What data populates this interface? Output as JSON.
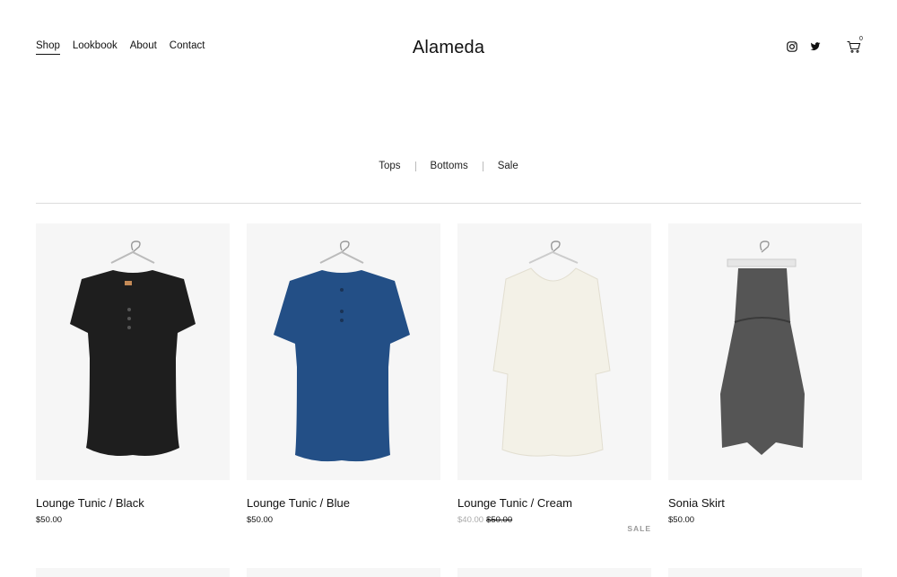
{
  "nav": {
    "items": [
      {
        "label": "Shop",
        "active": true
      },
      {
        "label": "Lookbook"
      },
      {
        "label": "About"
      },
      {
        "label": "Contact"
      }
    ]
  },
  "brand": "Alameda",
  "social": [
    "instagram-icon",
    "twitter-icon"
  ],
  "cart": {
    "count": "0",
    "icon": "cart-icon"
  },
  "categories": [
    "Tops",
    "Bottoms",
    "Sale"
  ],
  "products": [
    {
      "name": "Lounge Tunic / Black",
      "price": "$50.00",
      "color": "#1e1e1e"
    },
    {
      "name": "Lounge Tunic / Blue",
      "price": "$50.00",
      "color": "#234f86"
    },
    {
      "name": "Lounge Tunic / Cream",
      "sale_price": "$40.00",
      "original_price": "$50.00",
      "badge": "SALE",
      "color": "#f3f1e7"
    },
    {
      "name": "Sonia Skirt",
      "price": "$50.00",
      "color": "#555555"
    }
  ]
}
